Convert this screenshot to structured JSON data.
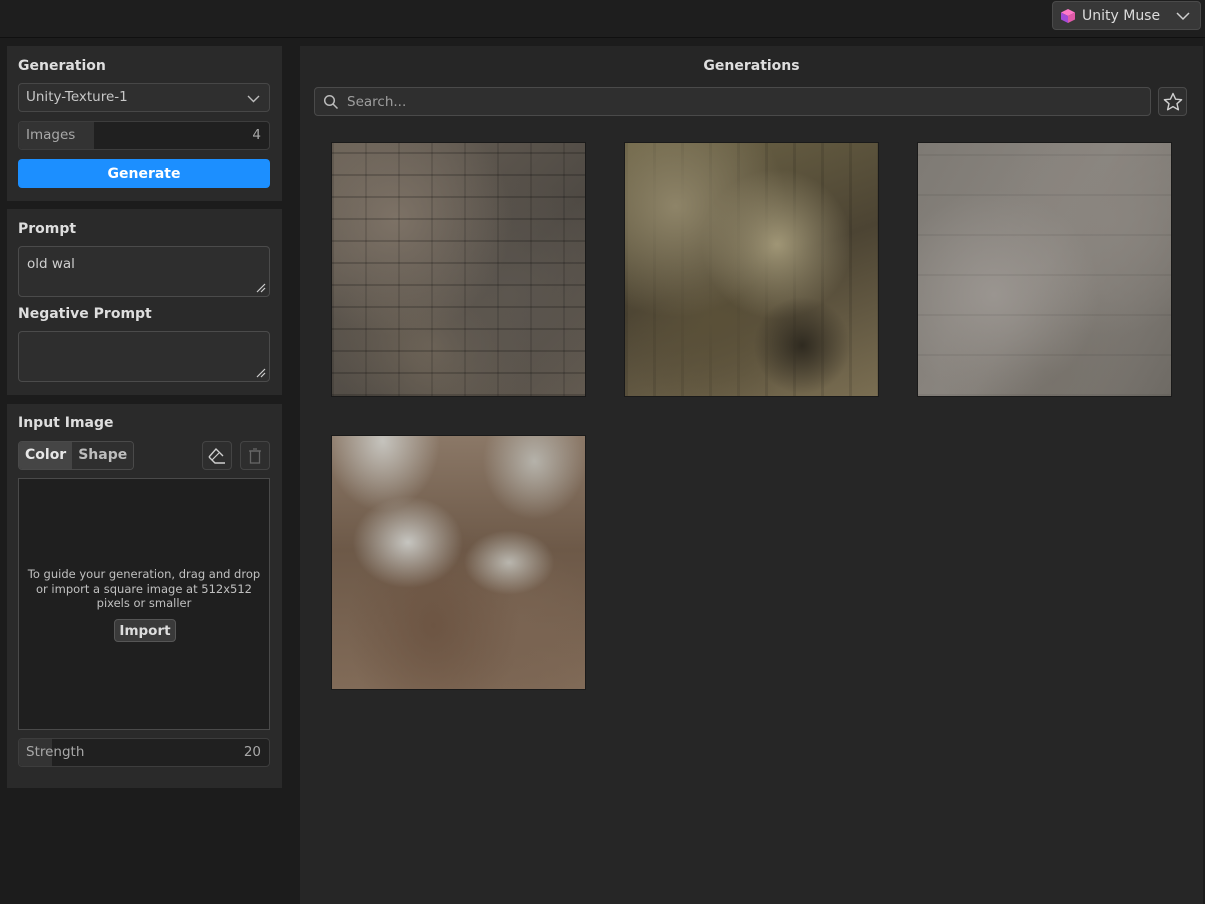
{
  "account": {
    "label": "Unity Muse"
  },
  "generation": {
    "title": "Generation",
    "model": "Unity-Texture-1",
    "images_label": "Images",
    "images_value": "4",
    "images_fill": 0.3,
    "generate_label": "Generate"
  },
  "prompt": {
    "title": "Prompt",
    "value": "old wal",
    "negative_title": "Negative Prompt",
    "negative_value": ""
  },
  "input_image": {
    "title": "Input Image",
    "tabs": [
      "Color",
      "Shape"
    ],
    "active_tab": "Color",
    "hint": "To guide your generation, drag and drop or import a square image at 512x512 pixels or smaller",
    "import_label": "Import",
    "strength_label": "Strength",
    "strength_value": "20",
    "strength_fill": 0.13
  },
  "main": {
    "title": "Generations",
    "search_placeholder": "Search...",
    "thumbnails": [
      "stone-wall-texture-1",
      "stone-wall-texture-2",
      "stone-wall-texture-3",
      "stone-wall-texture-4"
    ]
  },
  "colors": {
    "accent": "#1c8fff",
    "panel": "#2a2a2a",
    "background": "#1c1c1c"
  }
}
